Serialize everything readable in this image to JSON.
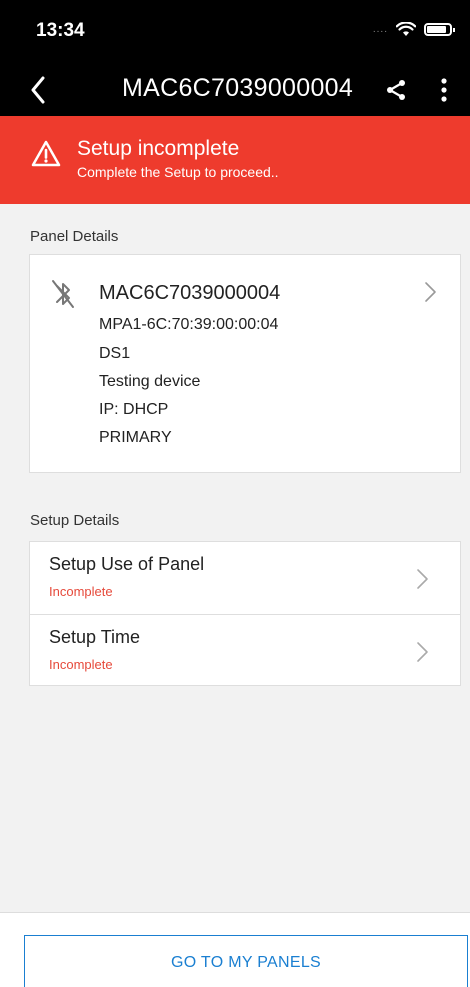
{
  "status_bar": {
    "time": "13:34",
    "signal": "....",
    "icons": [
      "wifi-icon",
      "battery-icon"
    ]
  },
  "nav": {
    "title": "MAC6C7039000004",
    "icons": [
      "back-icon",
      "share-icon",
      "more-icon"
    ]
  },
  "alert": {
    "title": "Setup incomplete",
    "subtitle": "Complete the Setup to proceed..",
    "icon": "warning-icon",
    "color": "#ee3b2d"
  },
  "panel_details": {
    "header": "Panel Details",
    "name": "MAC6C7039000004",
    "lines": [
      "MPA1-6C:70:39:00:00:04",
      "DS1",
      "Testing device",
      "IP: DHCP",
      "PRIMARY"
    ],
    "icon": "bluetooth-disabled-icon"
  },
  "setup_details": {
    "header": "Setup Details",
    "items": [
      {
        "title": "Setup Use of Panel",
        "status": "Incomplete"
      },
      {
        "title": "Setup Time",
        "status": "Incomplete"
      }
    ],
    "status_color": "#e64a3b"
  },
  "footer": {
    "button_label": "GO TO MY PANELS",
    "accent": "#1a7fd1"
  }
}
